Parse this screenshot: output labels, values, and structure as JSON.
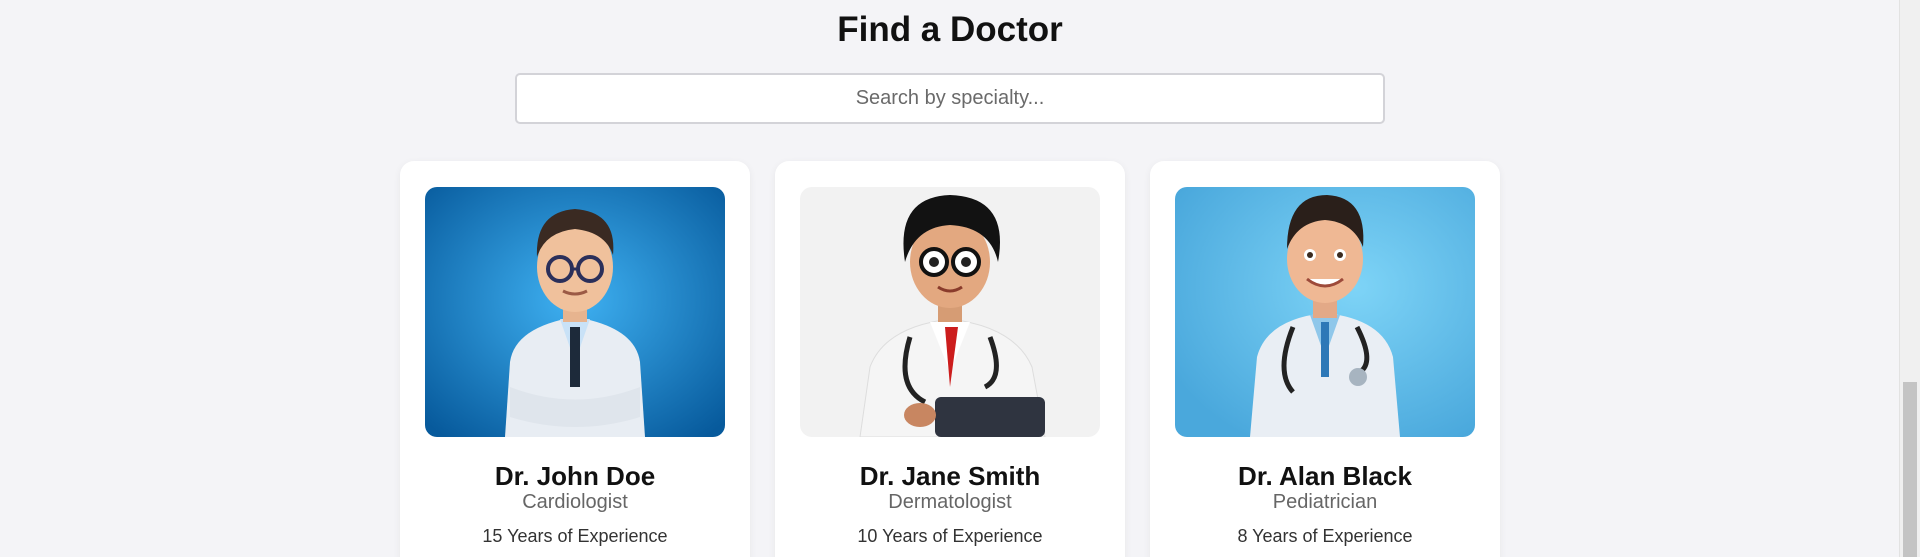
{
  "page": {
    "title": "Find a Doctor"
  },
  "search": {
    "placeholder": "Search by specialty...",
    "value": ""
  },
  "doctors": [
    {
      "name": "Dr. John Doe",
      "specialty": "Cardiologist",
      "experience": "15 Years of Experience",
      "photo_bg": "#0a6fb8"
    },
    {
      "name": "Dr. Jane Smith",
      "specialty": "Dermatologist",
      "experience": "10 Years of Experience",
      "photo_bg": "#f1f1f1"
    },
    {
      "name": "Dr. Alan Black",
      "specialty": "Pediatrician",
      "experience": "8 Years of Experience",
      "photo_bg": "#5ab8e6"
    }
  ],
  "colors": {
    "background": "#f4f4f7",
    "card": "#ffffff",
    "scrollbar_thumb": "#c4c4c4"
  }
}
